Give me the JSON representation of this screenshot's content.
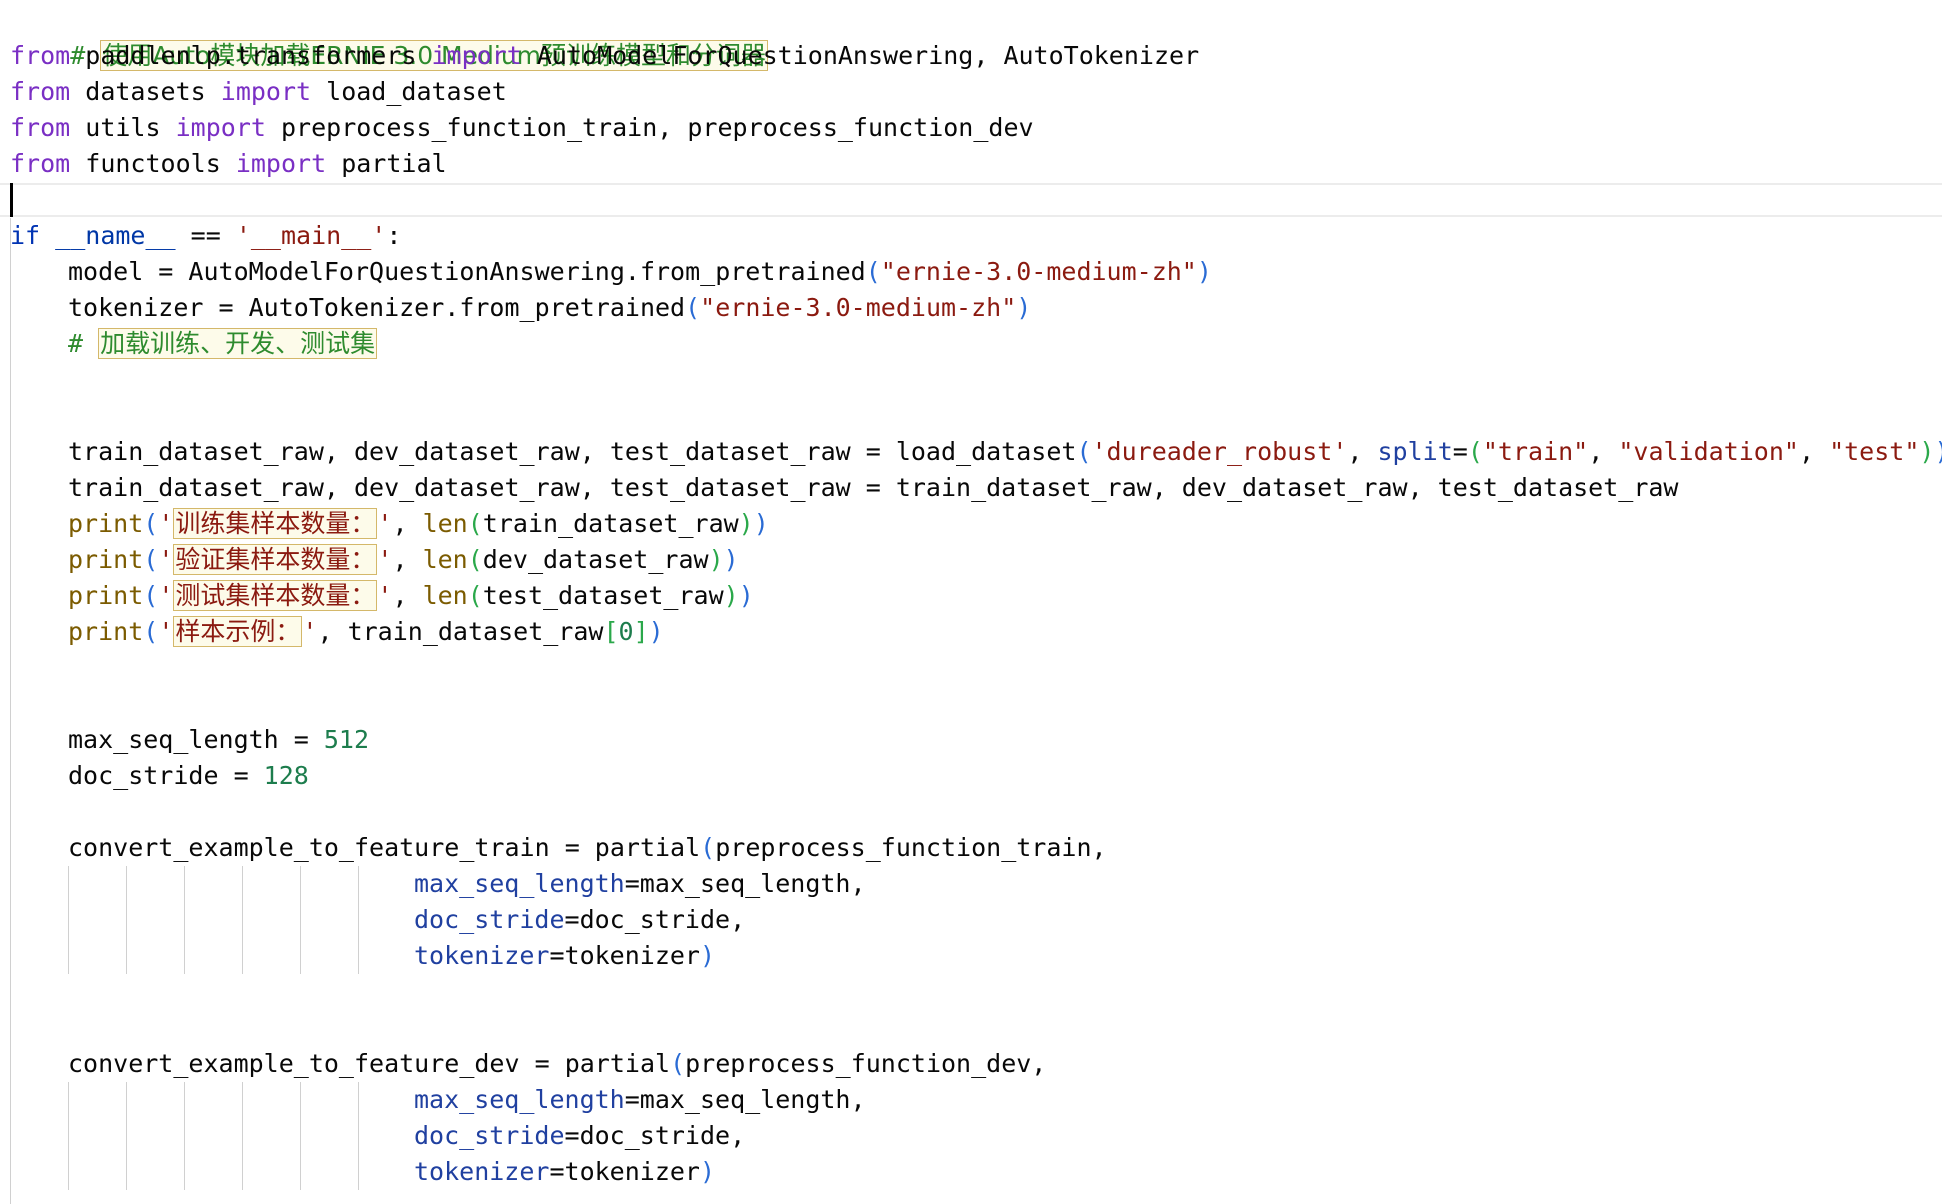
{
  "editor": {
    "comment_load_model": "# 使用Auto模块加载ERNIE 3.0 Medium预训练模型和分词器",
    "imports": [
      {
        "kw_from": "from",
        "module": "paddlenlp.transformers",
        "kw_import": "import",
        "names": "AutoModelForQuestionAnswering, AutoTokenizer"
      },
      {
        "kw_from": "from",
        "module": "datasets",
        "kw_import": "import",
        "names": "load_dataset"
      },
      {
        "kw_from": "from",
        "module": "utils",
        "kw_import": "import",
        "names": "preprocess_function_train, preprocess_function_dev"
      },
      {
        "kw_from": "from",
        "module": "functools",
        "kw_import": "import",
        "names": "partial"
      }
    ],
    "main_guard": {
      "kw_if": "if",
      "name": "__name__",
      "op": " == ",
      "str": "'__main__'",
      "colon": ":"
    },
    "model_line": {
      "lhs": "model = AutoModelForQuestionAnswering.from_pretrained",
      "arg": "\"ernie-3.0-medium-zh\""
    },
    "tokenizer_line": {
      "lhs": "tokenizer = AutoTokenizer.from_pretrained",
      "arg": "\"ernie-3.0-medium-zh\""
    },
    "comment_load_data": "# 加载训练、开发、测试集",
    "load_line": {
      "lhs": "train_dataset_raw, dev_dataset_raw, test_dataset_raw = load_dataset",
      "arg1": "'dureader_robust'",
      "kw": "split",
      "s1": "\"train\"",
      "s2": "\"validation\"",
      "s3": "\"test\""
    },
    "reassign_line": "train_dataset_raw, dev_dataset_raw, test_dataset_raw = train_dataset_raw, dev_dataset_raw, test_dataset_raw",
    "prints": [
      {
        "fn": "print",
        "label": "训练集样本数量：",
        "len": "len",
        "arg": "train_dataset_raw"
      },
      {
        "fn": "print",
        "label": "验证集样本数量：",
        "len": "len",
        "arg": "dev_dataset_raw"
      },
      {
        "fn": "print",
        "label": "测试集样本数量：",
        "len": "len",
        "arg": "test_dataset_raw"
      },
      {
        "fn": "print",
        "label": "样本示例：",
        "arg": "train_dataset_raw",
        "index": "0"
      }
    ],
    "max_seq_length": {
      "lhs": "max_seq_length = ",
      "value": "512"
    },
    "doc_stride": {
      "lhs": "doc_stride = ",
      "value": "128"
    },
    "train_partial": {
      "lhs": "convert_example_to_feature_train = partial",
      "first_arg": "preprocess_function_train,",
      "args": [
        {
          "name": "max_seq_length",
          "value": "=max_seq_length,"
        },
        {
          "name": "doc_stride",
          "value": "=doc_stride,"
        },
        {
          "name": "tokenizer",
          "value": "=tokenizer"
        }
      ]
    },
    "dev_partial": {
      "lhs": "convert_example_to_feature_dev = partial",
      "first_arg": "preprocess_function_dev,",
      "args": [
        {
          "name": "max_seq_length",
          "value": "=max_seq_length,"
        },
        {
          "name": "doc_stride",
          "value": "=doc_stride,"
        },
        {
          "name": "tokenizer",
          "value": "=tokenizer"
        }
      ]
    }
  }
}
